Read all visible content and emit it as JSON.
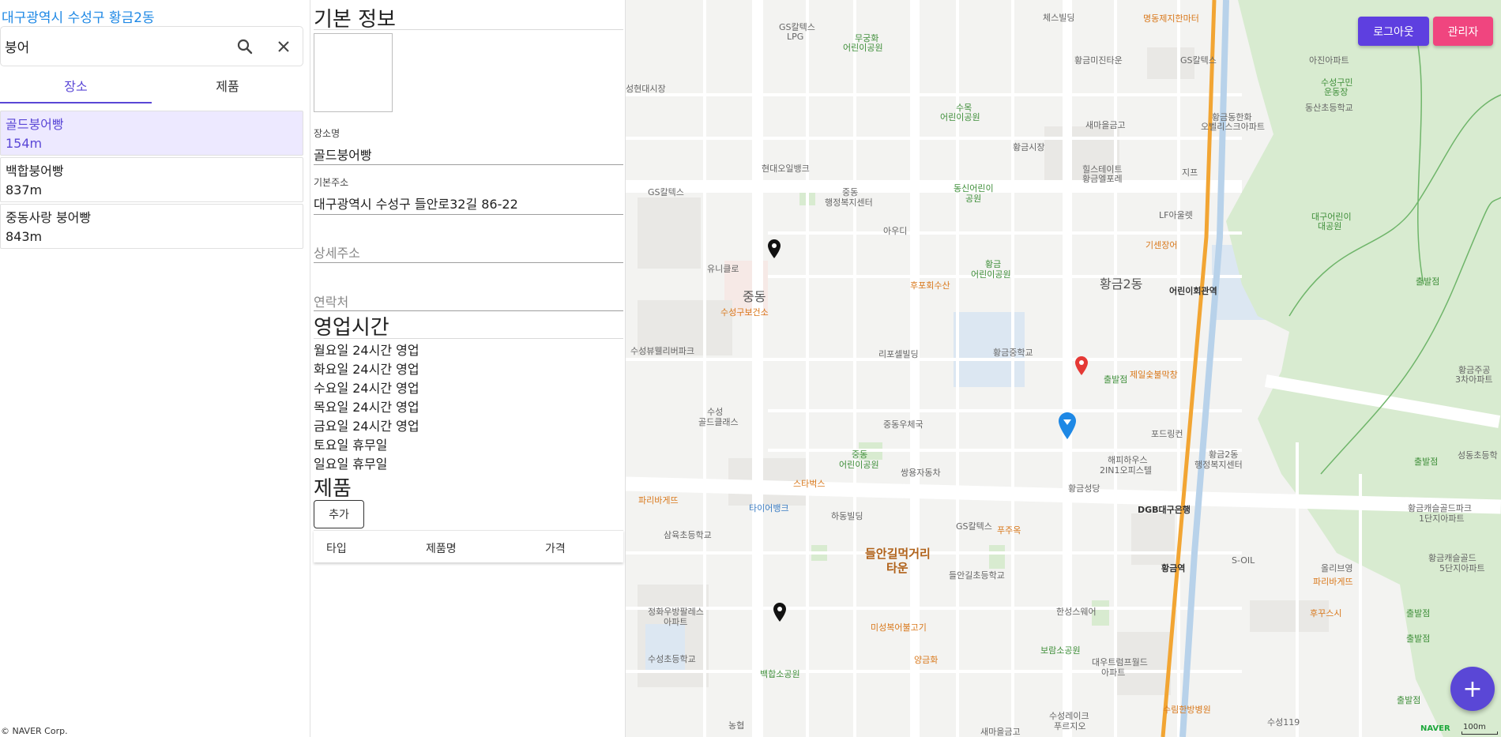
{
  "location_title": "대구광역시 수성구 황금2동",
  "search": {
    "value": "붕어"
  },
  "tabs": [
    {
      "label": "장소",
      "active": true
    },
    {
      "label": "제품",
      "active": false
    }
  ],
  "results": [
    {
      "name": "골드붕어빵",
      "distance": "154m",
      "selected": true
    },
    {
      "name": "백합붕어빵",
      "distance": "837m",
      "selected": false
    },
    {
      "name": "중동사랑 붕어빵",
      "distance": "843m",
      "selected": false
    }
  ],
  "copyright": "© NAVER Corp.",
  "detail": {
    "basic_title": "기본 정보",
    "name_label": "장소명",
    "name_value": "골드붕어빵",
    "address_label": "기본주소",
    "address_value": "대구광역시 수성구 들안로32길 86-22",
    "detail_address_placeholder": "상세주소",
    "contact_placeholder": "연락처",
    "hours_title": "영업시간",
    "hours": [
      "월요일 24시간 영업",
      "화요일 24시간 영업",
      "수요일 24시간 영업",
      "목요일 24시간 영업",
      "금요일 24시간 영업",
      "토요일 휴무일",
      "일요일 휴무일"
    ],
    "products_title": "제품",
    "add_button": "추가",
    "product_columns": [
      "타입",
      "제품명",
      "가격"
    ]
  },
  "map": {
    "buttons": {
      "logout": "로그아웃",
      "admin": "관리자"
    },
    "fab": "+",
    "logo": "NAVER",
    "scale": "100m",
    "colors": {
      "accent": "#5a47d6",
      "logout": "#5e3fe0",
      "admin": "#f0457f",
      "pin_selected": "#e53935",
      "pin_current": "#1e88e5"
    },
    "labels": {
      "l01": "체스빌딩",
      "l02": "명동제지한마터",
      "l03": "GS칼텍스",
      "l04": "LPG",
      "l05": "무궁화",
      "l06": "어린이공원",
      "l07": "황금미진타운",
      "l08": "GS칼텍스",
      "l09": "아진아파트",
      "l10": "수성구민",
      "l11": "운동장",
      "l12": "성현대시장",
      "l13": "수목",
      "l14": "어린이공원",
      "l15": "새마을금고",
      "l16": "황금동한화",
      "l17": "오벨리스크아파트",
      "l18": "동산초등학교",
      "l19": "황금시장",
      "l20": "힐스테이트",
      "l21": "황금엘포레",
      "l22": "지프",
      "l23": "현대오일뱅크",
      "l24": "동신어린이",
      "l25": "공원",
      "l26": "중동",
      "l27": "행정복지센터",
      "l28": "GS칼텍스",
      "l29": "LF아울렛",
      "l30": "대구어린이",
      "l31": "대공원",
      "l32": "아우디",
      "l33": "기센장어",
      "l34": "유니클로",
      "l35": "황금",
      "l36": "어린이공원",
      "l37": "황금2동",
      "l38": "어린이회관역",
      "l39": "출발점",
      "l40": "후포회수산",
      "l41": "중동",
      "l42": "수성구보건소",
      "l43": "황금중학교",
      "l44": "리포셀빌딩",
      "l45": "제일숯불막창",
      "l46": "수성뷰웰리버파크",
      "l47": "황금주공",
      "l48": "3차아파트",
      "l49": "출발점",
      "l50": "수성",
      "l51": "골드클래스",
      "l52": "중동우체국",
      "l53": "포드링컨",
      "l54": "해피하우스",
      "l55": "2IN1오피스텔",
      "l56": "황금2동",
      "l57": "행정복지센터",
      "l58": "성동초등학",
      "l59": "출발점",
      "l60": "중동",
      "l61": "어린이공원",
      "l62": "쌍용자동차",
      "l63": "스타벅스",
      "l64": "황금성당",
      "l65": "파리바게뜨",
      "l66": "타이어뱅크",
      "l67": "하동빌딩",
      "l68": "DGB대구은행",
      "l69": "황금캐슬골드파크",
      "l70": "1단지아파트",
      "l71": "삼육초등학교",
      "l72": "GS칼텍스",
      "l73": "푸주옥",
      "l74": "들안길먹거리",
      "l75": "타운",
      "l76": "황금역",
      "l77": "S-OIL",
      "l78": "올리브영",
      "l79": "황금캐슬골드",
      "l80": "5단지아파트",
      "l81": "들안길초등학교",
      "l82": "파리바게뜨",
      "l83": "정화우방팔레스",
      "l84": "아파트",
      "l85": "한성스웨어",
      "l86": "후꾸스시",
      "l87": "출발점",
      "l88": "미성복어불고기",
      "l89": "보람소공원",
      "l90": "출발점",
      "l91": "수성초등학교",
      "l92": "양금화",
      "l93": "대우트럼프월드",
      "l94": "아파트",
      "l95": "백합소공원",
      "l96": "수림한방병원",
      "l97": "출발점",
      "l98": "농협",
      "l99": "새마을금고",
      "l100": "수성레이크",
      "l101": "푸르지오",
      "l102": "수성119"
    }
  }
}
